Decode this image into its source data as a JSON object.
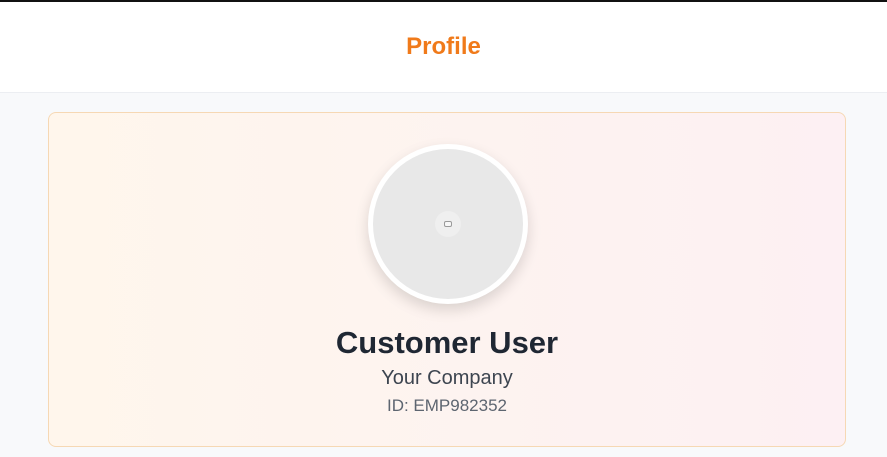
{
  "header": {
    "title": "Profile"
  },
  "profile": {
    "name": "Customer User",
    "company": "Your Company",
    "employee_id": "ID: EMP982352",
    "avatar_icon": "image-placeholder-icon"
  },
  "colors": {
    "accent": "#f07a1a",
    "card_border": "#f6d8b4",
    "name_text": "#1f2733"
  }
}
